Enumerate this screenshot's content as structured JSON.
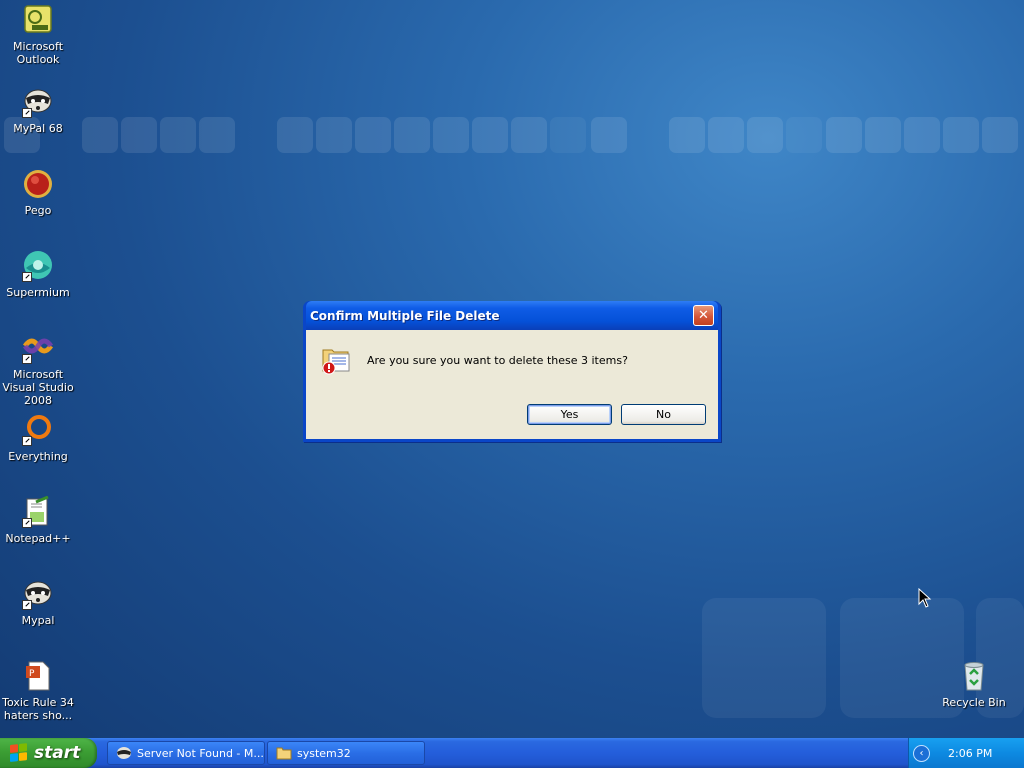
{
  "desktop": {
    "icons": [
      {
        "label": "Microsoft Outlook",
        "icon": "outlook-icon"
      },
      {
        "label": "MyPal 68",
        "icon": "mypal-icon"
      },
      {
        "label": "Pego",
        "icon": "pego-icon"
      },
      {
        "label": "Supermium",
        "icon": "supermium-icon"
      },
      {
        "label": "Microsoft Visual Studio 2008",
        "icon": "visual-studio-icon"
      },
      {
        "label": "Everything",
        "icon": "everything-icon"
      },
      {
        "label": "Notepad++",
        "icon": "notepadpp-icon"
      },
      {
        "label": "Mypal",
        "icon": "mypal-icon"
      },
      {
        "label": "Toxic Rule 34 haters sho...",
        "icon": "powerpoint-file-icon"
      },
      {
        "label": "Recycle Bin",
        "icon": "recycle-bin-icon"
      }
    ]
  },
  "dialog": {
    "title": "Confirm Multiple File Delete",
    "close_glyph": "✕",
    "message": "Are you sure you want to delete these 3 items?",
    "yes_label": "Yes",
    "no_label": "No",
    "icon": "delete-files-warning-icon"
  },
  "taskbar": {
    "start_label": "start",
    "tasks": [
      {
        "label": "Server Not Found - M...",
        "icon": "mypal-icon"
      },
      {
        "label": "system32",
        "icon": "folder-icon"
      }
    ],
    "tray_arrow_glyph": "‹",
    "clock": "2:06 PM"
  },
  "colors": {
    "desktop": "#2a6aae",
    "titlebar": "#0551d8",
    "dialog_face": "#ece9d8",
    "start_green": "#3c9e34",
    "tray": "#0d8ae2"
  }
}
